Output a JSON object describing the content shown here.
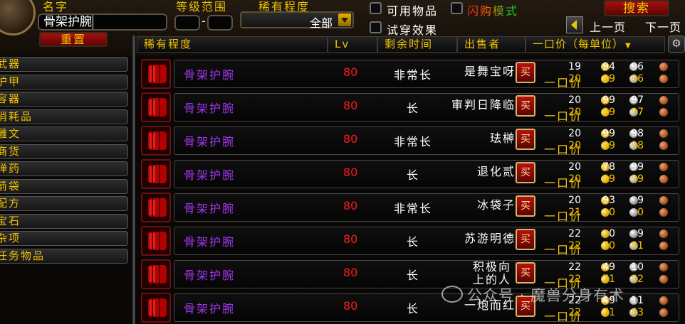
{
  "search": {
    "name_label": "名字",
    "name_value": "骨架护腕",
    "level_label": "等级范围",
    "level_min": "",
    "level_max": "",
    "level_dash": "-",
    "rarity_label": "稀有程度",
    "rarity_selected": "全部",
    "reset_label": "重置",
    "usable_label": "可用物品",
    "flash_label": "闪购模式",
    "tryon_label": "试穿效果",
    "search_label": "搜索",
    "prev_label": "上一页",
    "next_label": "下一页"
  },
  "columns": {
    "rarity": "稀有程度",
    "lv": "Lv",
    "time": "剩余时间",
    "seller": "出售者",
    "price": "一口价（每单位）"
  },
  "categories": [
    "武器",
    "护甲",
    "容器",
    "消耗品",
    "雕文",
    "商货",
    "弹药",
    "箭袋",
    "配方",
    "宝石",
    "杂项",
    "任务物品"
  ],
  "buy_label": "买",
  "buyout_label": "一口价",
  "rows": [
    {
      "name": "骨架护腕",
      "lv": "80",
      "time": "非常长",
      "seller": "是舞宝呀",
      "bid": [
        "19",
        "94",
        "96"
      ],
      "buyout": [
        "20",
        "99",
        "96"
      ]
    },
    {
      "name": "骨架护腕",
      "lv": "80",
      "time": "长",
      "seller": "审判日降临",
      "bid": [
        "20",
        "99",
        "97"
      ],
      "buyout": [
        "20",
        "99",
        "97"
      ]
    },
    {
      "name": "骨架护腕",
      "lv": "80",
      "time": "非常长",
      "seller": "珐榊",
      "bid": [
        "20",
        "99",
        "98"
      ],
      "buyout": [
        "20",
        "99",
        "98"
      ]
    },
    {
      "name": "骨架护腕",
      "lv": "80",
      "time": "长",
      "seller": "退化贰",
      "bid": [
        "20",
        "78",
        "99"
      ],
      "buyout": [
        "20",
        "99",
        "99"
      ]
    },
    {
      "name": "骨架护腕",
      "lv": "80",
      "time": "非常长",
      "seller": "冰袋子",
      "bid": [
        "20",
        "93",
        "9"
      ],
      "buyout": [
        "21",
        "0",
        "0"
      ]
    },
    {
      "name": "骨架护腕",
      "lv": "80",
      "time": "长",
      "seller": "苏游明德",
      "bid": [
        "22",
        "0",
        "9"
      ],
      "buyout": [
        "22",
        "70",
        "81"
      ]
    },
    {
      "name": "骨架护腕",
      "lv": "80",
      "time": "长",
      "seller": "积极向上的人",
      "bid": [
        "22",
        "49",
        "10"
      ],
      "buyout": [
        "22",
        "71",
        "82"
      ]
    },
    {
      "name": "骨架护腕",
      "lv": "80",
      "time": "长",
      "seller": "一炮而红",
      "bid": [
        "22",
        "49",
        "11"
      ],
      "buyout": [
        "22",
        "71",
        "83"
      ]
    }
  ],
  "watermark": "公众号 · 魔兽分身有术"
}
